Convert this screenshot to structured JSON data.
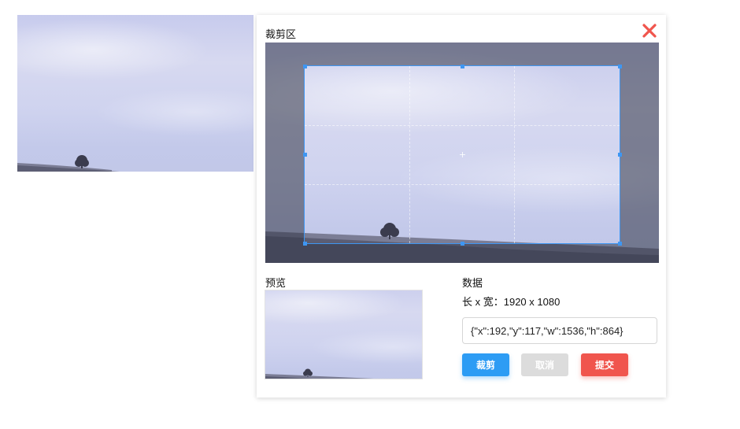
{
  "dialog": {
    "title": "裁剪区",
    "close_icon": "close-icon"
  },
  "preview": {
    "label": "预览"
  },
  "data_panel": {
    "label": "数据",
    "size_label": "长 x 宽：",
    "size_value": "1920 x 1080",
    "crop_json_value": "{\"x\":192,\"y\":117,\"w\":1536,\"h\":864}"
  },
  "buttons": {
    "crop": "裁剪",
    "cancel": "取消",
    "submit": "提交"
  },
  "colors": {
    "accent": "#2d9cf4",
    "danger": "#f0554d",
    "disabled": "#dcdcdc",
    "crop_border": "#3e96f2"
  }
}
